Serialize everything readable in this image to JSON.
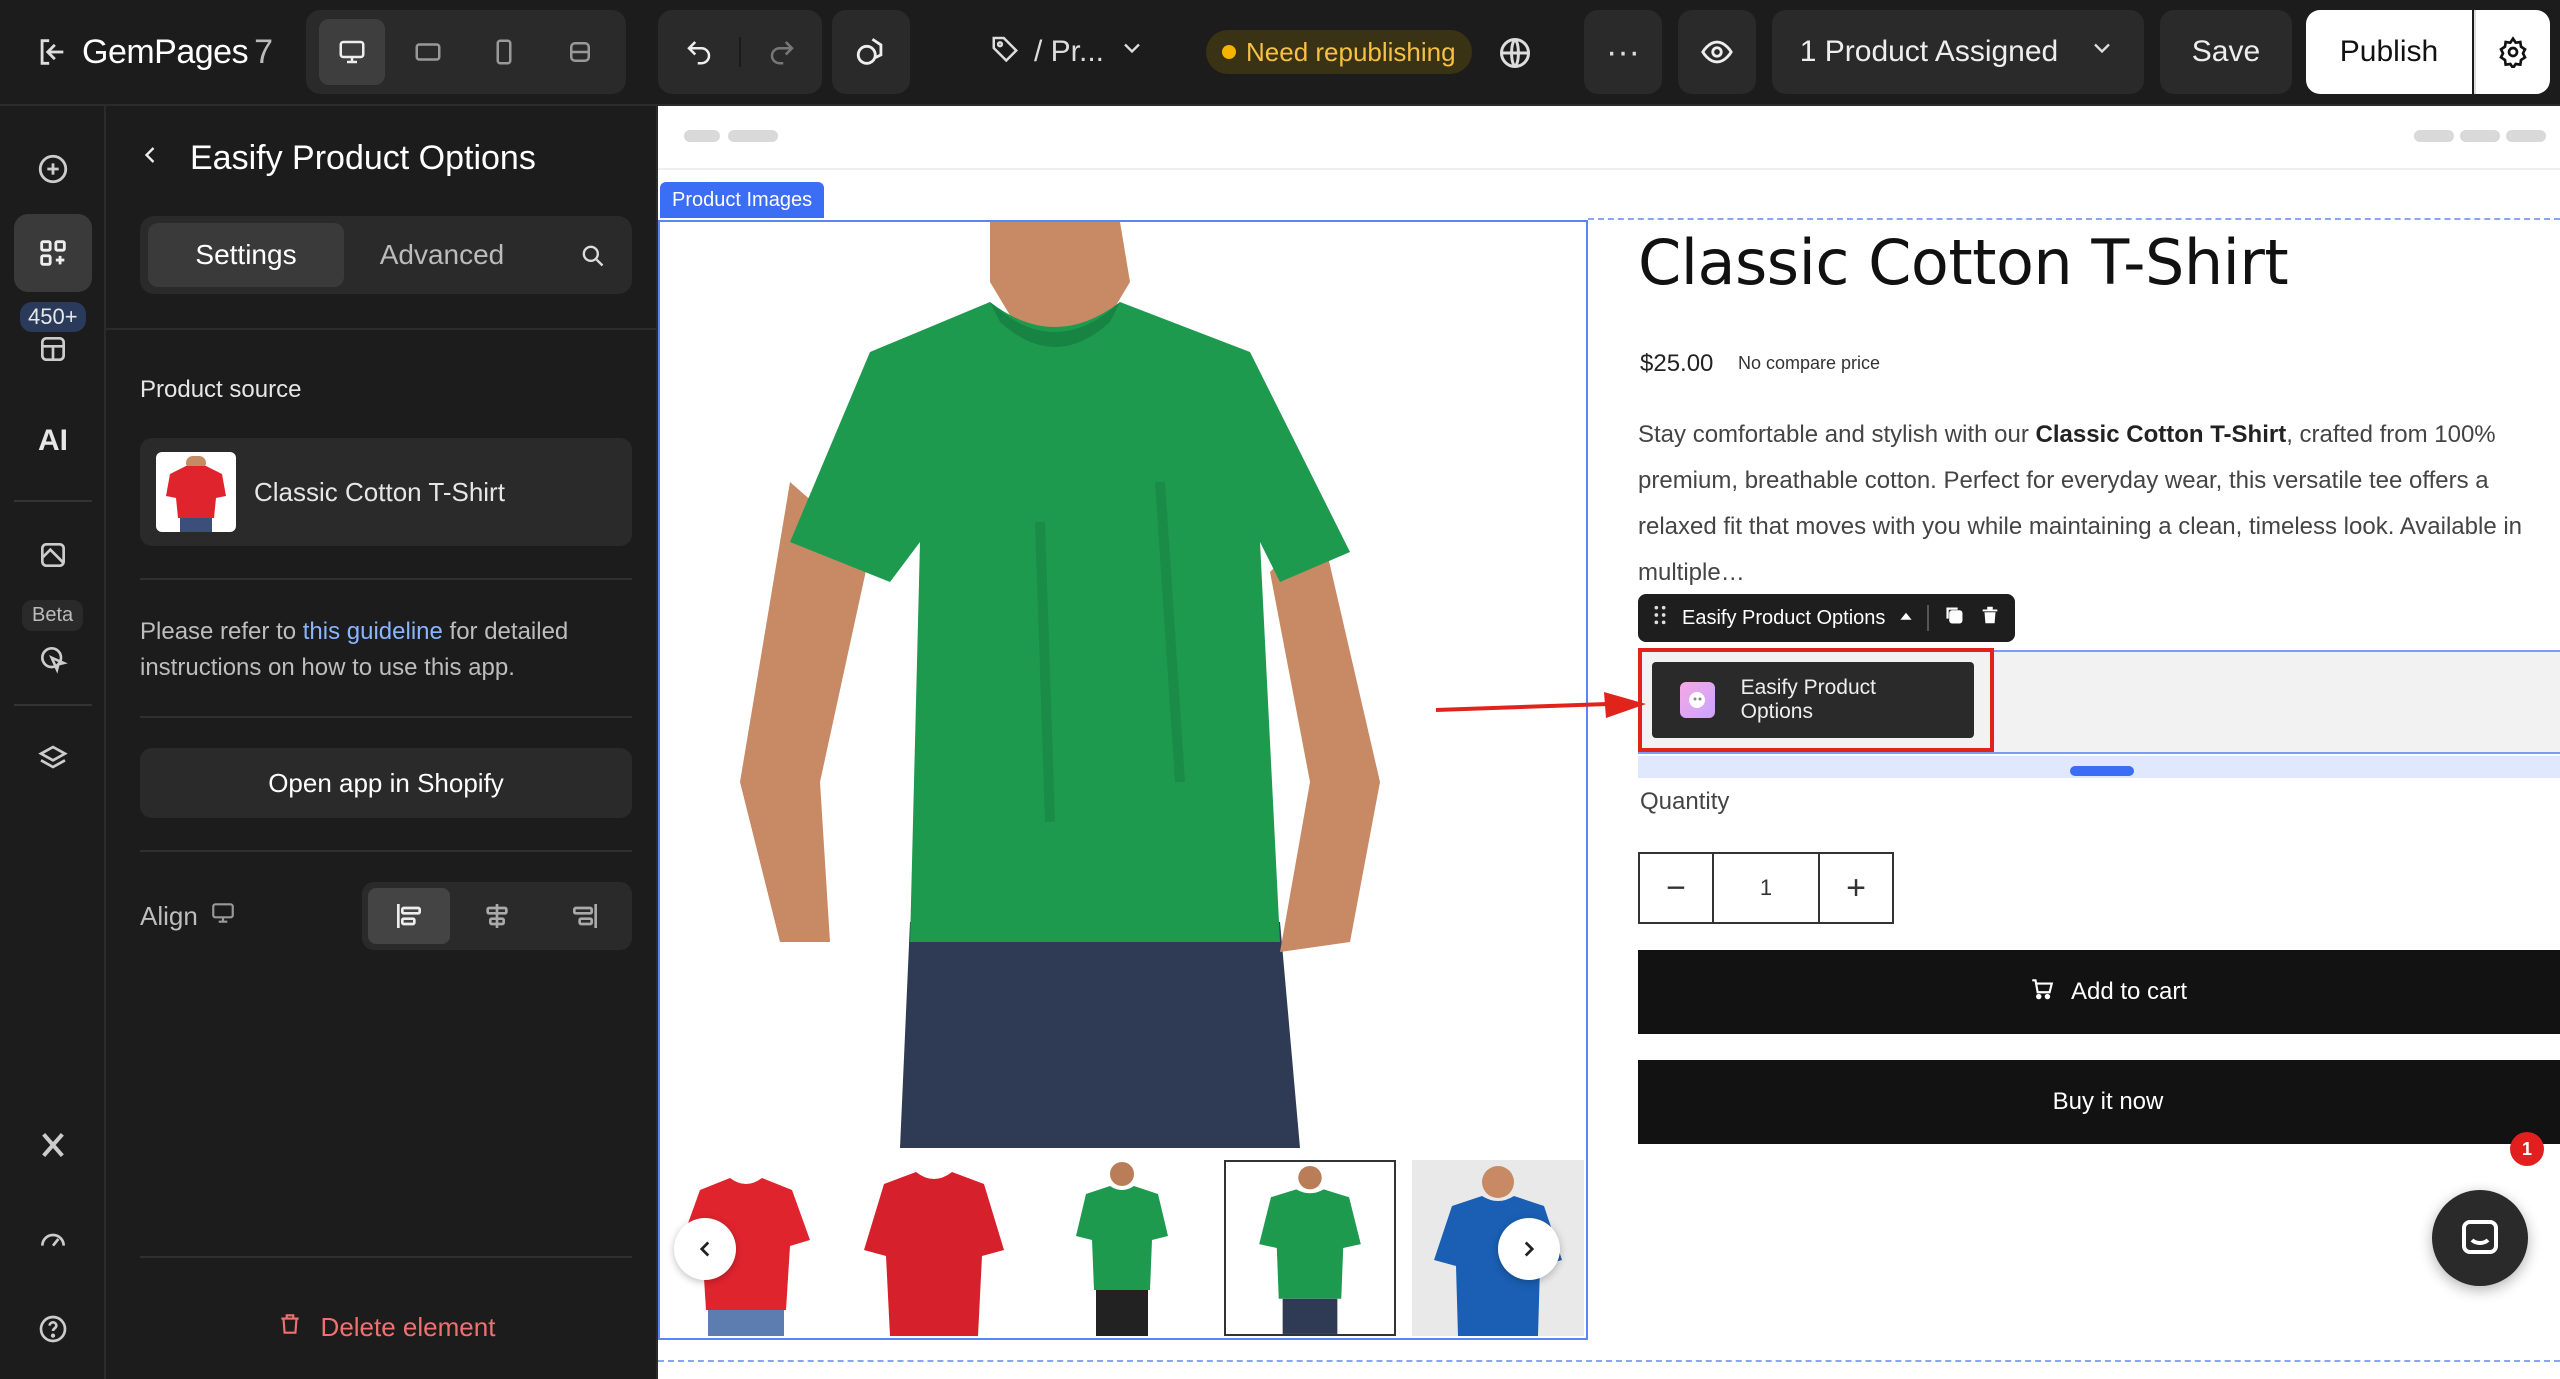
{
  "app": {
    "brand": "GemPages",
    "version": "7"
  },
  "topbar": {
    "page_name": "/ Pr...",
    "status": "Need republishing",
    "more": "···",
    "product_assigned": "1 Product Assigned",
    "save": "Save",
    "publish": "Publish"
  },
  "rail": {
    "elements_count": "450+",
    "ai_label": "AI",
    "beta_label": "Beta"
  },
  "panel": {
    "title": "Easify Product Options",
    "tabs": [
      {
        "label": "Settings"
      },
      {
        "label": "Advanced"
      }
    ],
    "product_source_label": "Product source",
    "product_source_name": "Classic Cotton T-Shirt",
    "guide_prefix": "Please refer to ",
    "guide_link": "this guideline",
    "guide_suffix": " for detailed instructions on how to use this app.",
    "open_app": "Open app in Shopify",
    "align_label": "Align",
    "delete": "Delete element"
  },
  "canvas": {
    "product_images_label": "Product Images",
    "product": {
      "title": "Classic Cotton T-Shirt",
      "price": "$25.00",
      "compare_price": "No compare price",
      "desc_1": "Stay comfortable and stylish with our ",
      "desc_bold": "Classic Cotton T-Shirt",
      "desc_2": ", crafted from 100% premium, breathable cotton. Perfect for everyday wear, this versatile tee offers a relaxed fit that moves with you while maintaining a clean, timeless look. Available in multiple…",
      "quantity_label": "Quantity",
      "quantity_value": "1",
      "add_to_cart": "Add to cart",
      "buy_now": "Buy it now"
    },
    "easify": {
      "toolbar_label": "Easify Product Options",
      "widget_label": "Easify Product Options"
    },
    "chat_badge": "1"
  },
  "colors": {
    "accent_blue": "#3b6ef5",
    "status_yellow": "#f5b400",
    "highlight_red": "#e0241b",
    "shirt_green": "#1e9a4f",
    "shirt_red": "#e0242e",
    "shirt_blue": "#1a5fb4"
  },
  "icons": [
    "exit-icon",
    "desktop-icon",
    "tablet-landscape-icon",
    "mobile-icon",
    "fullwidth-icon",
    "undo-icon",
    "redo-icon",
    "shapes-icon",
    "tag-icon",
    "chevron-down-icon",
    "globe-icon",
    "eye-icon",
    "gear-icon",
    "add-icon",
    "elements-icon",
    "sections-icon",
    "ai-icon",
    "theme-icon",
    "beta-cursor-icon",
    "layers-icon",
    "x-logo-icon",
    "speed-icon",
    "help-icon",
    "chevron-left-icon",
    "search-icon",
    "desktop-small-icon",
    "align-left-icon",
    "align-center-icon",
    "align-right-icon",
    "trash-icon",
    "drag-handle-icon",
    "caret-up-icon",
    "duplicate-icon",
    "cart-icon",
    "chat-icon",
    "arrow-right-icon"
  ]
}
